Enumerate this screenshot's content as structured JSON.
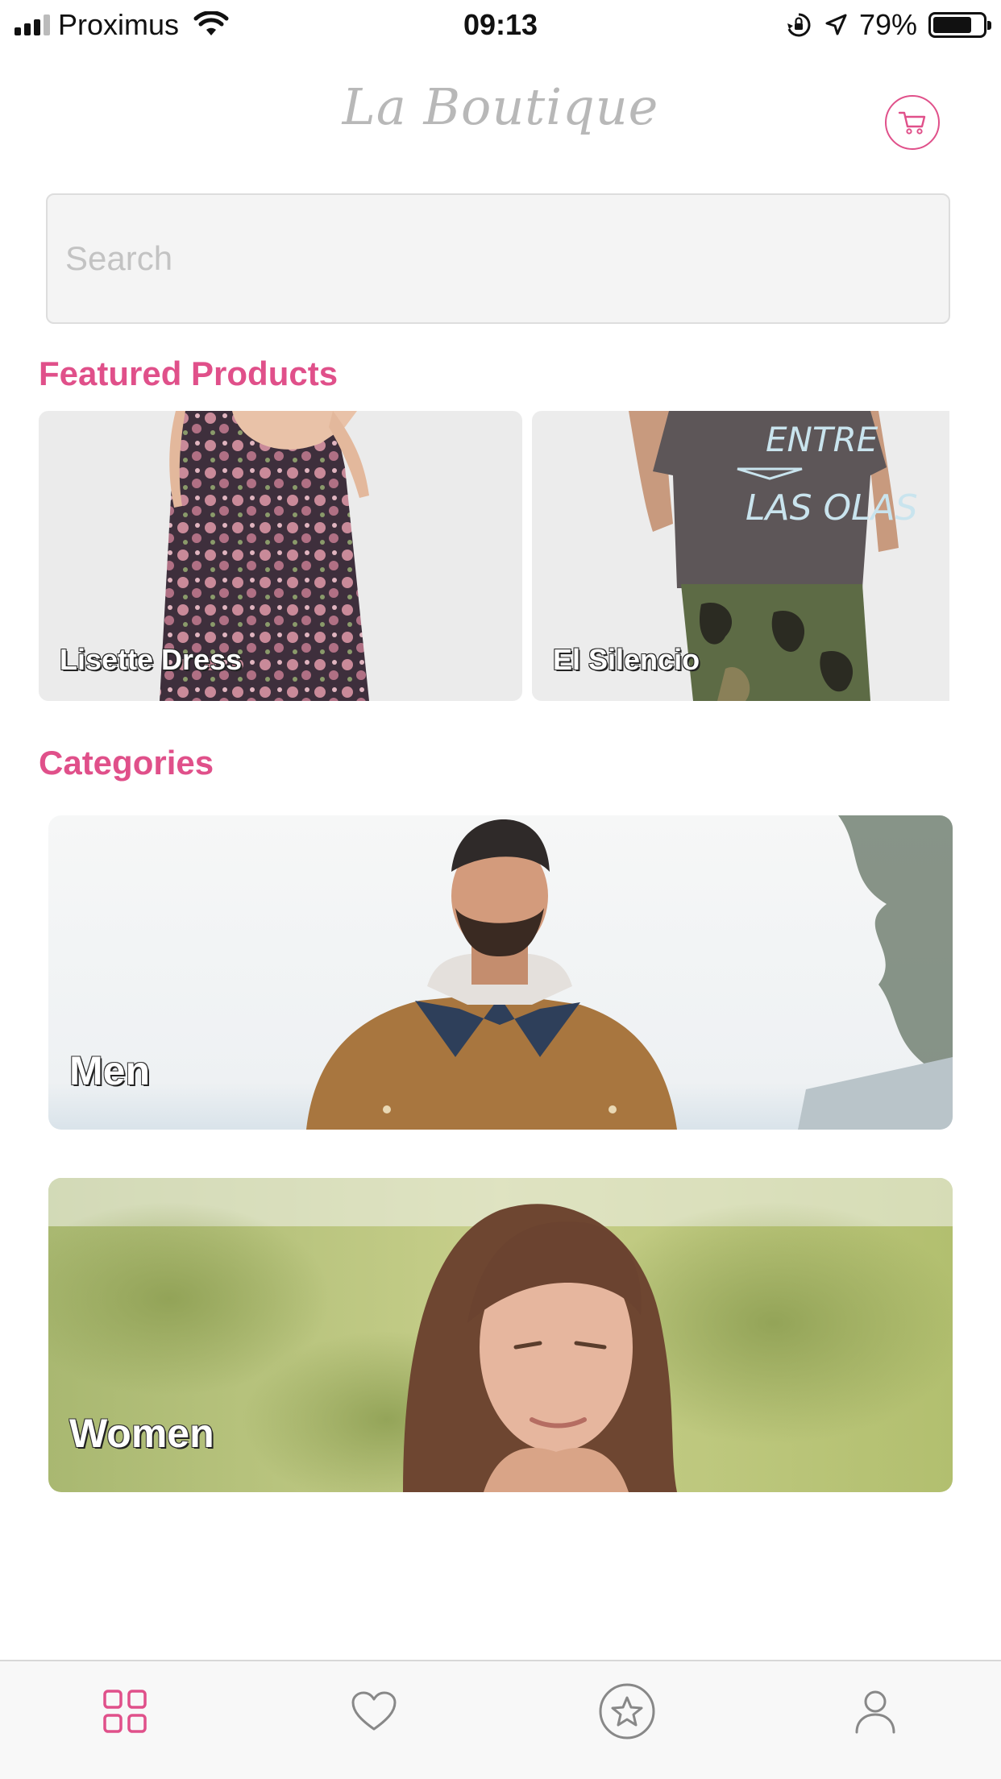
{
  "status_bar": {
    "carrier": "Proximus",
    "time": "09:13",
    "battery_percent": "79%",
    "battery_level": 0.79,
    "signal_bars": 3
  },
  "header": {
    "title": "La Boutique",
    "cart_icon": "shopping-cart-icon"
  },
  "search": {
    "placeholder": "Search",
    "value": ""
  },
  "featured": {
    "title": "Featured Products",
    "items": [
      {
        "label": "Lisette Dress"
      },
      {
        "label": "El Silencio"
      }
    ]
  },
  "categories": {
    "title": "Categories",
    "items": [
      {
        "label": "Men"
      },
      {
        "label": "Women"
      }
    ]
  },
  "tab_bar": {
    "items": [
      {
        "icon": "grid-icon",
        "active": true
      },
      {
        "icon": "heart-icon",
        "active": false
      },
      {
        "icon": "star-circle-icon",
        "active": false
      },
      {
        "icon": "user-icon",
        "active": false
      }
    ]
  },
  "colors": {
    "accent": "#e0508a",
    "inactive_icon": "#888888",
    "title_gray": "#b8b8b8"
  }
}
